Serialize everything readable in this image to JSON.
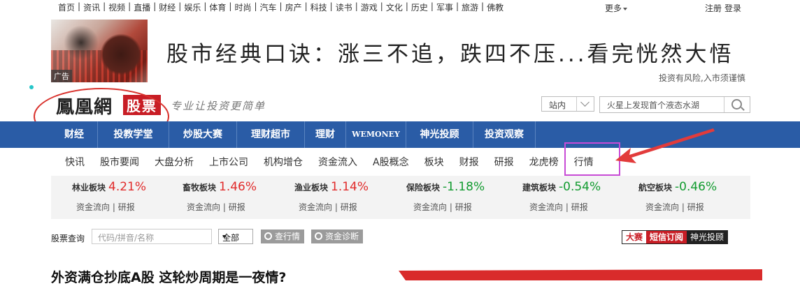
{
  "top_nav": {
    "links": [
      "首页",
      "资讯",
      "视频",
      "直播",
      "财经",
      "娱乐",
      "体育",
      "时尚",
      "汽车",
      "房产",
      "科技",
      "读书",
      "游戏",
      "文化",
      "历史",
      "军事",
      "旅游",
      "佛教"
    ],
    "more": "更多",
    "register": "注册",
    "login": "登录"
  },
  "ad": {
    "tag": "广告",
    "headline": "股市经典口诀：涨三不追，跌四不压...看完恍然大悟",
    "risk_note": "投资有风险,入市须谨慎"
  },
  "logo": {
    "brand": "鳳凰網",
    "section": "股票",
    "slogan": "专业让投资更简单"
  },
  "search": {
    "scope": "站内",
    "placeholder": "火星上发现首个液态水湖"
  },
  "main_nav": [
    "财经",
    "投教学堂",
    "炒股大赛",
    "理财超市",
    "理财",
    "WEMONEY",
    "神光投顾",
    "投资观察"
  ],
  "sub_nav": [
    "快讯",
    "股市要闻",
    "大盘分析",
    "上市公司",
    "机构增仓",
    "资金流入",
    "A股概念",
    "板块",
    "财报",
    "研报",
    "龙虎榜",
    "行情"
  ],
  "sectors": [
    {
      "name": "林业板块",
      "change": "4.21%",
      "direction": "up"
    },
    {
      "name": "畜牧板块",
      "change": "1.46%",
      "direction": "up"
    },
    {
      "name": "渔业板块",
      "change": "1.14%",
      "direction": "up"
    },
    {
      "name": "保险板块",
      "change": "-1.18%",
      "direction": "down"
    },
    {
      "name": "建筑板块",
      "change": "-0.54%",
      "direction": "down"
    },
    {
      "name": "航空板块",
      "change": "-0.46%",
      "direction": "down"
    }
  ],
  "sector_links": {
    "flow": "资金流向",
    "sep": "|",
    "report": "研报"
  },
  "stock_query": {
    "label": "股票查询",
    "placeholder": "代码/拼音/名称",
    "select_value": "全部",
    "quote_btn": "查行情",
    "diag_btn": "资金诊断"
  },
  "right_tabs": [
    "大赛",
    "短信订阅",
    "神光投顾"
  ],
  "headline": "外资满仓抄底A股 这轮炒周期是一夜情?",
  "colors": {
    "nav_blue": "#2a5ca6",
    "brand_red": "#c81d25",
    "up": "#e12b2b",
    "down": "#119b2f",
    "highlight": "#c84bd6"
  }
}
